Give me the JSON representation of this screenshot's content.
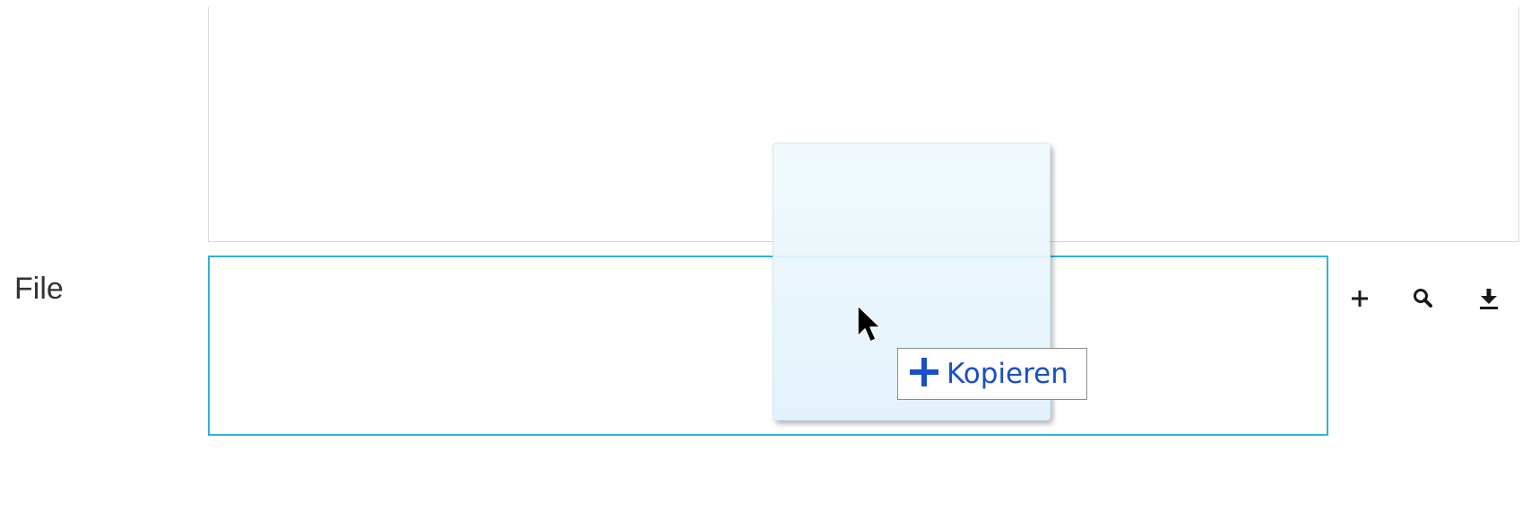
{
  "form": {
    "file_label": "File"
  },
  "actions": {
    "add_icon": "plus-icon",
    "search_icon": "search-icon",
    "download_icon": "download-icon"
  },
  "drag": {
    "tooltip_icon": "plus-icon",
    "tooltip_label": "Kopieren"
  },
  "colors": {
    "drop_zone_border": "#2eb0e0",
    "tooltip_text": "#1a4fc6"
  }
}
